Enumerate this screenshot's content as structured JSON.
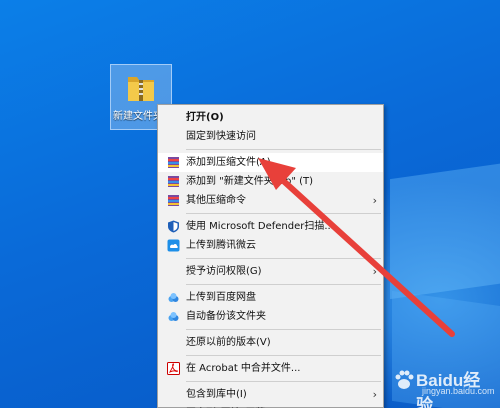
{
  "desktop_icon": {
    "label": "新建文件夹"
  },
  "context_menu": {
    "items": [
      {
        "label": "打开(O)",
        "bold": true
      },
      {
        "label": "固定到快速访问"
      },
      {
        "sep": true
      },
      {
        "label": "添加到压缩文件(A)...",
        "icon": "winrar-icon",
        "highlighted": true
      },
      {
        "label": "添加到 \"新建文件夹.zip\" (T)",
        "icon": "winrar-icon"
      },
      {
        "label": "其他压缩命令",
        "icon": "winrar-icon",
        "submenu": true
      },
      {
        "sep": true
      },
      {
        "label": "使用 Microsoft Defender扫描...",
        "icon": "defender-shield-icon"
      },
      {
        "label": "上传到腾讯微云",
        "icon": "weiyun-icon"
      },
      {
        "sep": true
      },
      {
        "label": "授予访问权限(G)",
        "submenu": true
      },
      {
        "sep": true
      },
      {
        "label": "上传到百度网盘",
        "icon": "baidu-netdisk-icon"
      },
      {
        "label": "自动备份该文件夹",
        "icon": "baidu-netdisk-icon"
      },
      {
        "sep": true
      },
      {
        "label": "还原以前的版本(V)"
      },
      {
        "sep": true
      },
      {
        "label": "在 Acrobat 中合并文件...",
        "icon": "acrobat-icon"
      },
      {
        "sep": true
      },
      {
        "label": "包含到库中(I)",
        "submenu": true
      },
      {
        "label": "固定到\"开始\"屏幕(P)"
      }
    ]
  },
  "watermark": {
    "brand": "Baidu经验",
    "sub": "jingyan.baidu.com"
  },
  "colors": {
    "arrow": "#e8403a",
    "menu_bg": "#f2f2f2",
    "highlight": "#ffffff"
  }
}
